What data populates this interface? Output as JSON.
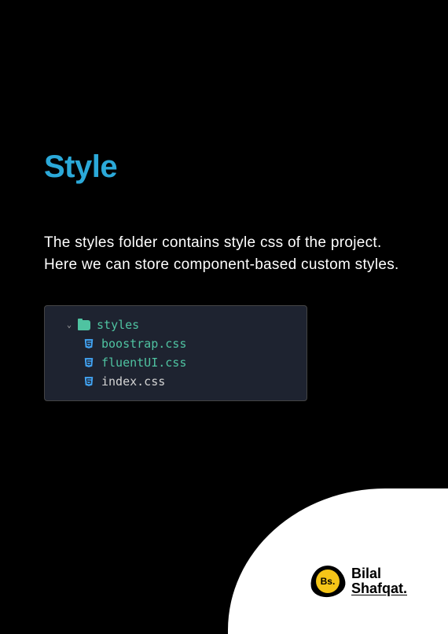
{
  "title": "Style",
  "description": "The styles folder contains style css of the project. Here we can store component-based custom styles.",
  "explorer": {
    "folder": "styles",
    "files": [
      {
        "name": "boostrap.css",
        "color": "green"
      },
      {
        "name": "fluentUI.css",
        "color": "green"
      },
      {
        "name": "index.css",
        "color": "white"
      }
    ]
  },
  "author": {
    "logoText": "Bs.",
    "firstName": "Bilal",
    "lastName": "Shafqat."
  }
}
